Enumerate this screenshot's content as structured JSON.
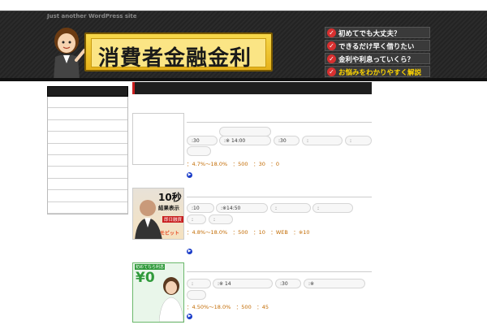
{
  "header": {
    "tagline": "Just another WordPress site",
    "site_title": "消費者金融金利",
    "features": [
      {
        "label": "初めてでも大丈夫？",
        "highlight": false
      },
      {
        "label": "できるだけ早く借りたい",
        "highlight": false
      },
      {
        "label": "金利や利息っていくら？",
        "highlight": false
      },
      {
        "label": "お悩みをわかりやすく解説",
        "highlight": true
      }
    ]
  },
  "sidebar": {
    "heading": "",
    "items": [
      "",
      "",
      "",
      "",
      "",
      "",
      "",
      "",
      "",
      ""
    ]
  },
  "main": {
    "heading": "",
    "intro": "",
    "cards": [
      {
        "thumb_label": "",
        "name": "",
        "specs": [
          ":30",
          ":※ 14:00",
          ":30",
          ":",
          ":"
        ],
        "desc": "：4.7%～18.0%　：500　：30　：0",
        "more": ""
      },
      {
        "thumb_big": "10秒",
        "thumb_mid": "結果表示",
        "thumb_small": "即日融資",
        "thumb_brand": "モビット",
        "name": "",
        "specs": [
          ":10",
          ":※14:50",
          ":",
          ":",
          ":",
          ":"
        ],
        "desc": "：4.8%～18.0%　：500　：10　：WEB　：※10",
        "more": ""
      },
      {
        "thumb_top": "初めてなら利息",
        "thumb_big": "¥0",
        "name": "",
        "specs": [
          ":",
          ":※ 14",
          ":30",
          ":※"
        ],
        "desc": "：4.50%～18.0%　：500　：45",
        "more": ""
      }
    ]
  },
  "colors": {
    "accent_red": "#c81e1e",
    "link_blue": "#1a3cc8",
    "desc_orange": "#c26a00",
    "logo_yellow": "#f7d84a"
  }
}
